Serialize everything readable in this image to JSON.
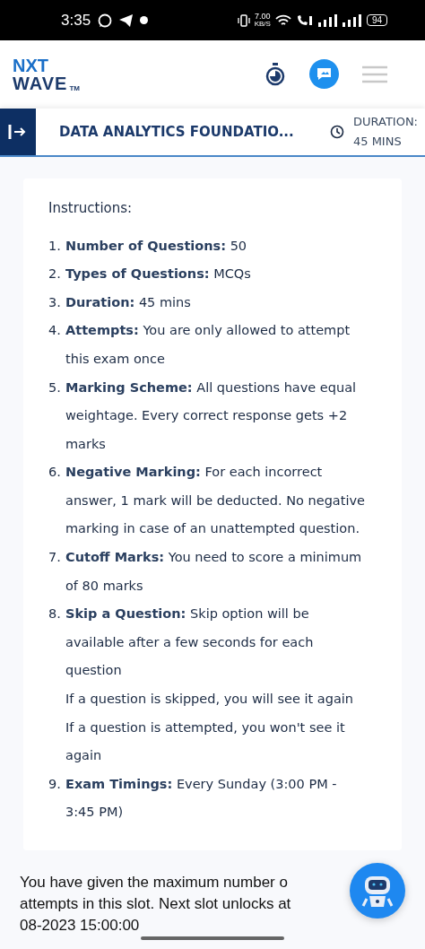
{
  "status_bar": {
    "time": "3:35",
    "speed_value": "7.00",
    "speed_unit": "KB/S",
    "battery": "94"
  },
  "header": {
    "logo_top": "NXT",
    "logo_bottom": "WAVE",
    "logo_mark": "TM"
  },
  "exam_bar": {
    "title": "DATA ANALYTICS FOUNDATIO...",
    "duration_label": "DURATION:",
    "duration_value": "45 MINS"
  },
  "instructions": {
    "heading": "Instructions:",
    "items": [
      {
        "number": "1.",
        "text": "**Number of Questions:** 50"
      },
      {
        "number": "2.",
        "text": "**Types of Questions:** MCQs"
      },
      {
        "number": "3.",
        "text": "**Duration:**  45 mins"
      },
      {
        "number": "4.",
        "text": "**Attempts:**  You are only allowed to attempt this exam once"
      },
      {
        "number": "5.",
        "text": "**Marking Scheme:** All questions have equal weightage. Every correct response gets +2 marks"
      },
      {
        "number": "6.",
        "text": "**Negative Marking:** For each incorrect answer, 1 mark will be deducted. No negative marking in case of an unattempted question."
      },
      {
        "number": "7.",
        "text": "**Cutoff Marks:** You need to score a minimum of 80 marks"
      },
      {
        "number": "8.",
        "text": "**Skip a Question:** Skip option will be available after a few seconds for each question",
        "notes": [
          "If a question is skipped, you will see it again",
          "If a question is attempted, you won't see it again"
        ]
      },
      {
        "number": "9.",
        "text": "**Exam Timings:**  Every Sunday (3:00 PM - 3:45 PM)"
      }
    ]
  },
  "notice": {
    "lines": [
      "You have given the maximum number o",
      "attempts in this slot. Next slot unlocks at",
      "08-2023 15:00:00"
    ]
  }
}
